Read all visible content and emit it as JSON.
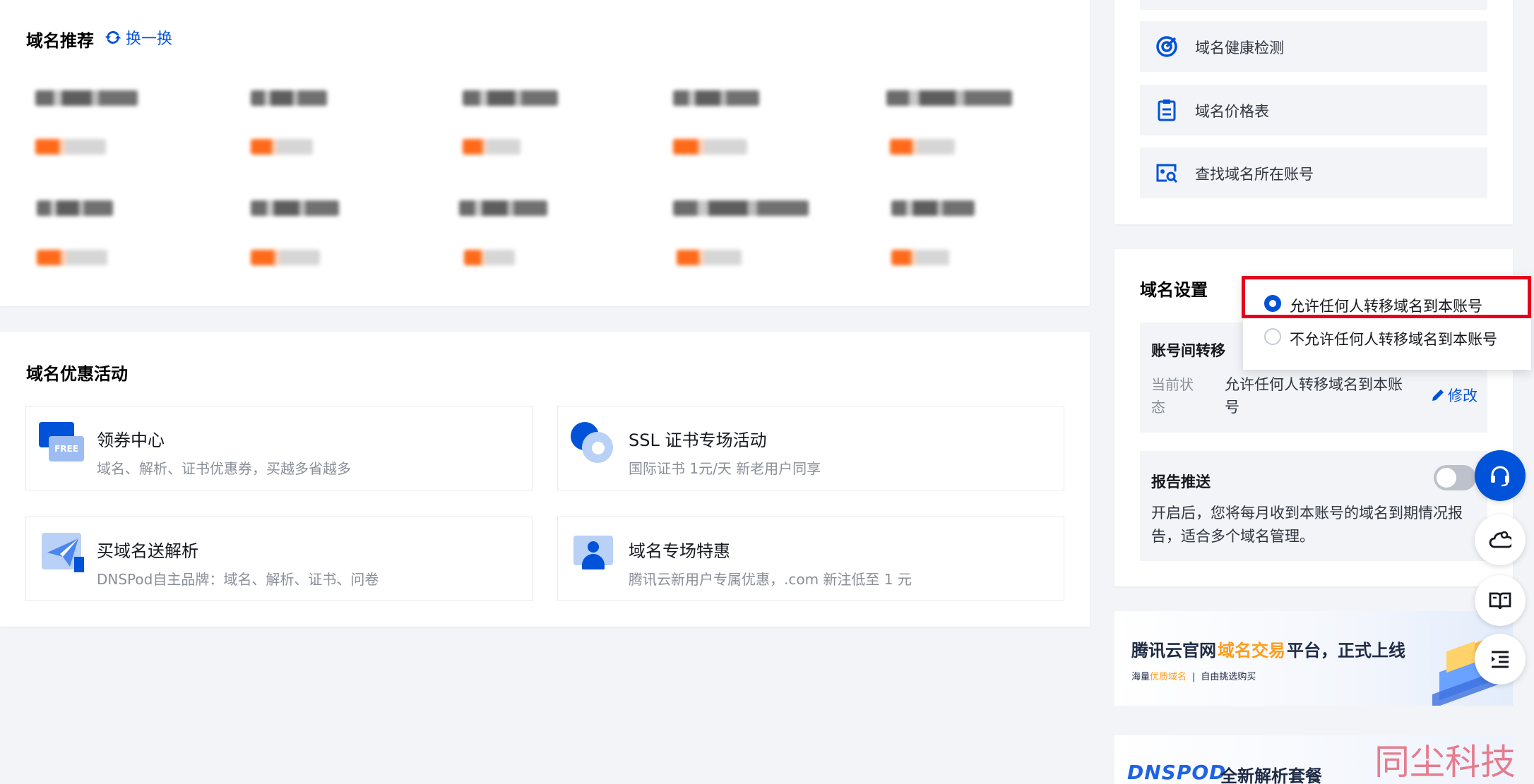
{
  "recommend": {
    "title": "域名推荐",
    "refresh_label": "换一换"
  },
  "promotions": {
    "title": "域名优惠活动",
    "items": [
      {
        "title": "领券中心",
        "desc": "域名、解析、证书优惠券，买越多省越多"
      },
      {
        "title": "SSL 证书专场活动",
        "desc": "国际证书 1元/天 新老用户同享"
      },
      {
        "title": "买域名送解析",
        "desc": "DNSPod自主品牌：域名、解析、证书、问卷"
      },
      {
        "title": "域名专场特惠",
        "desc": "腾讯云新用户专属优惠，.com 新注低至 1 元"
      }
    ],
    "coupon_badge": "FREE"
  },
  "tools": {
    "items": [
      {
        "label": "域名健康检测",
        "icon": "target-icon"
      },
      {
        "label": "域名价格表",
        "icon": "clipboard-icon"
      },
      {
        "label": "查找域名所在账号",
        "icon": "search-account-icon"
      }
    ]
  },
  "settings": {
    "title": "域名设置",
    "transfer": {
      "title": "账号间转移",
      "status_label": "当前状态",
      "status_value": "允许任何人转移域名到本账号",
      "edit_label": "修改"
    },
    "dropdown": {
      "options": [
        "允许任何人转移域名到本账号",
        "不允许任何人转移域名到本账号"
      ],
      "selected_index": 0
    },
    "report": {
      "title": "报告推送",
      "enabled": false,
      "desc": "开启后，您将每月收到本账号的域名到期情况报告，适合多个域名管理。"
    }
  },
  "banners": {
    "trade": {
      "title_prefix": "腾讯云官网",
      "title_highlight": "域名交易",
      "title_suffix": "平台，正式上线",
      "sub_prefix": "海量",
      "sub_highlight": "优质域名",
      "sub_sep": "|",
      "sub_suffix": "自由挑选购买"
    },
    "dnspod": {
      "logo": "DNSPOD",
      "text": "全新解析套餐"
    }
  },
  "float_buttons": [
    "headset-icon",
    "cloud-user-icon",
    "book-icon",
    "list-indent-icon"
  ],
  "watermark": "同尘科技",
  "colors": {
    "accent": "#0052d9",
    "orange": "#ff7e1a",
    "highlight_red": "#e5001c"
  }
}
